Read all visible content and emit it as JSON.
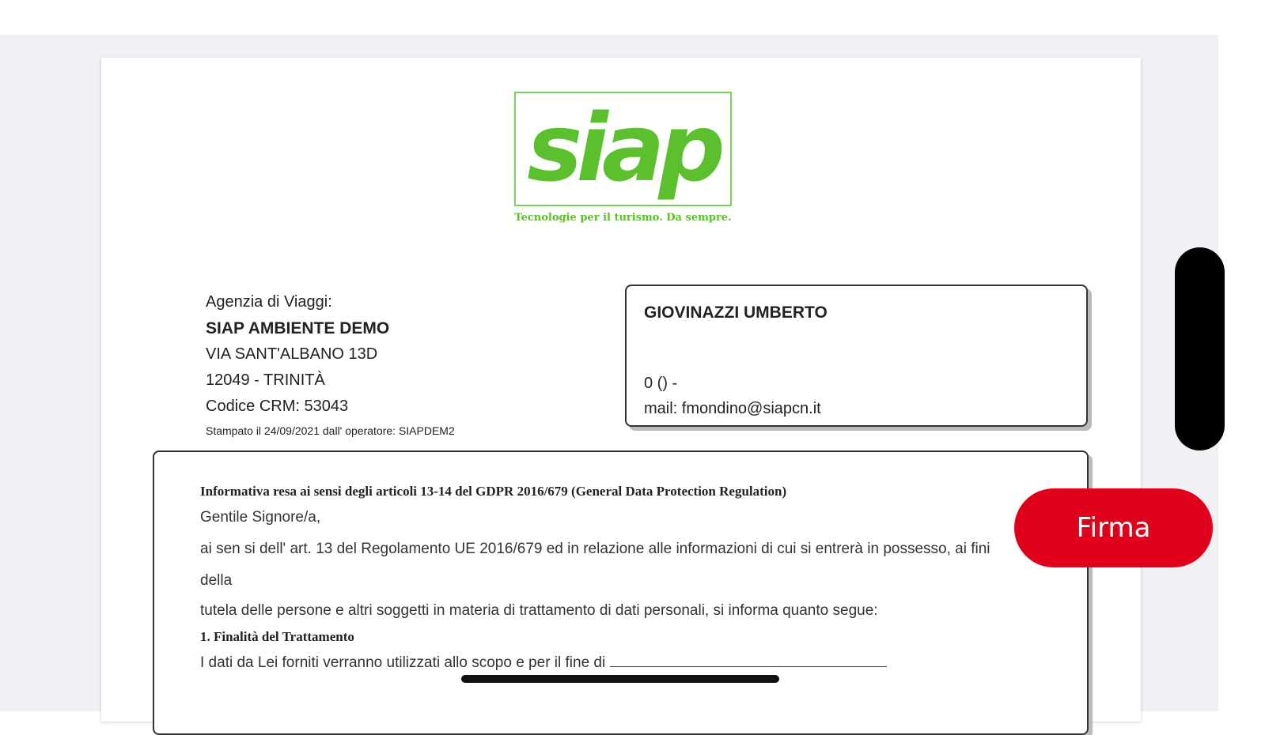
{
  "logo": {
    "text": "siap",
    "tagline": "Tecnologie per il turismo. Da sempre."
  },
  "agency": {
    "label": "Agenzia di Viaggi:",
    "name": "SIAP AMBIENTE DEMO",
    "address": "VIA SANT'ALBANO 13D",
    "city": "12049 - TRINITÀ",
    "crm": "Codice CRM: 53043",
    "printed": "Stampato il 24/09/2021 dall' operatore: SIAPDEM2"
  },
  "client": {
    "name": "GIOVINAZZI UMBERTO",
    "phone": "0  () -",
    "mail": "mail: fmondino@siapcn.it"
  },
  "info": {
    "heading": "Informativa resa ai sensi degli articoli 13-14 del GDPR 2016/679 (General Data Protection Regulation)",
    "greeting": "Gentile Signore/a,",
    "line1": "ai sen si dell'   art. 13 del Regolamento UE 2016/679 ed in relazione alle informazioni di cui si entrerà in possesso, ai fini",
    "line2": "della",
    "line3": "tutela delle persone e altri soggetti in materia di trattamento di dati personali, si informa quanto segue:",
    "section1": "1. Finalità del Trattamento",
    "line4": "I dati da Lei forniti verranno utilizzati allo scopo e per il fine di"
  },
  "actions": {
    "firma": "Firma"
  },
  "colors": {
    "brand_green": "#5bbf2e",
    "firma_red": "#e0001b"
  }
}
